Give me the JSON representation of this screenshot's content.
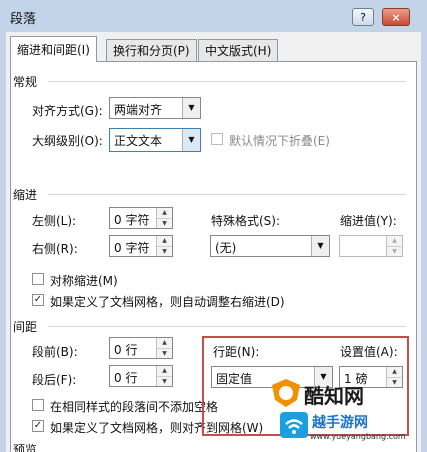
{
  "dialog": {
    "title": "段落",
    "help_label": "?",
    "close_label": "×"
  },
  "tabs": [
    {
      "label": "缩进和间距(I)"
    },
    {
      "label": "换行和分页(P)"
    },
    {
      "label": "中文版式(H)"
    }
  ],
  "general": {
    "heading": "常规",
    "alignment_label": "对齐方式(G):",
    "alignment_value": "两端对齐",
    "outline_label": "大纲级别(O):",
    "outline_value": "正文文本",
    "collapse_label": "默认情况下折叠(E)"
  },
  "indent": {
    "heading": "缩进",
    "left_label": "左侧(L):",
    "left_value": "0 字符",
    "right_label": "右侧(R):",
    "right_value": "0 字符",
    "special_label": "特殊格式(S):",
    "special_value": "(无)",
    "by_label": "缩进值(Y):",
    "mirror_label": "对称缩进(M)",
    "auto_adjust_label": "如果定义了文档网格，则自动调整右缩进(D)"
  },
  "spacing": {
    "heading": "间距",
    "before_label": "段前(B):",
    "before_value": "0 行",
    "after_label": "段后(F):",
    "after_value": "0 行",
    "line_spacing_label": "行距(N):",
    "line_spacing_value": "固定值",
    "at_label": "设置值(A):",
    "at_value": "1 磅",
    "no_space_label": "在相同样式的段落间不添加空格",
    "snap_grid_label": "如果定义了文档网格，则对齐到网格(W)"
  },
  "preview": {
    "heading": "预览"
  },
  "watermark": {
    "brand": "酷知网",
    "sub": "越手游网",
    "url": "www.yueyangbang.com"
  },
  "colors": {
    "highlight": "#c0504d",
    "title_bg": "#c4d4e8"
  }
}
